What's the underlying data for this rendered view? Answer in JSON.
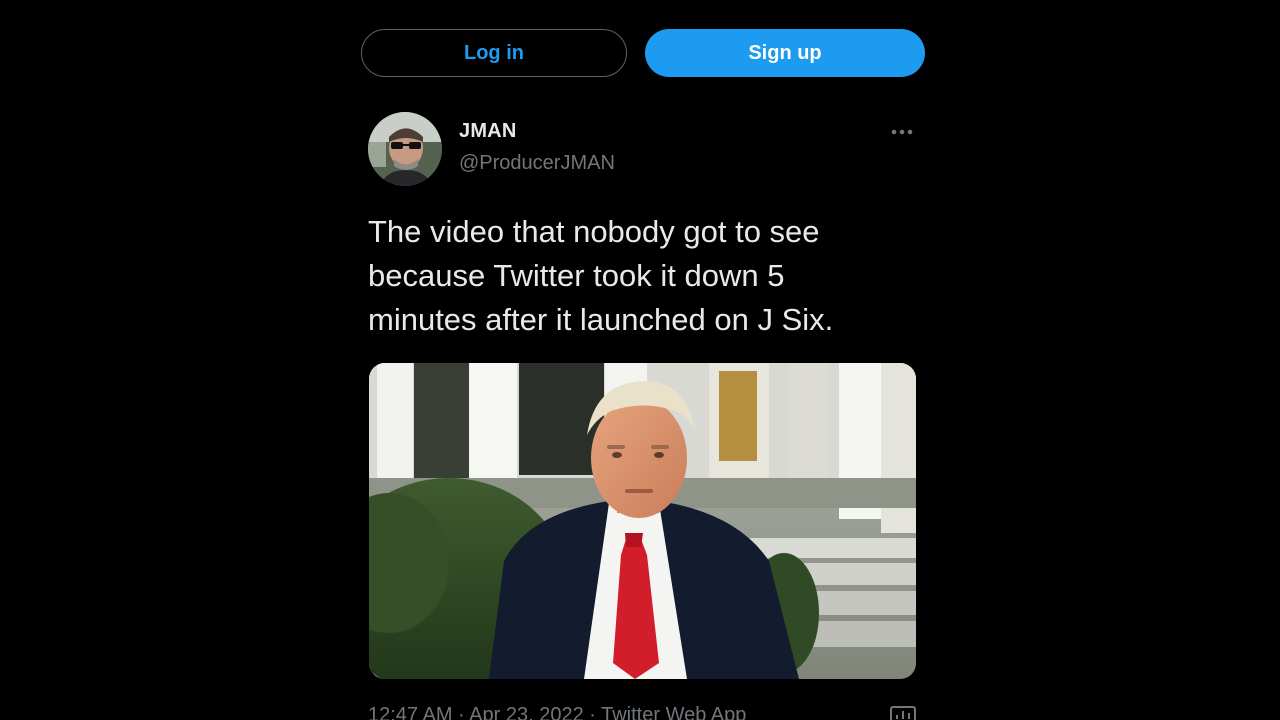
{
  "auth": {
    "login_label": "Log in",
    "signup_label": "Sign up"
  },
  "tweet": {
    "author": {
      "display_name": "JMAN",
      "handle": "@ProducerJMAN"
    },
    "text": "The video that nobody got to see\nbecause Twitter took it down 5\nminutes after it launched on J Six.",
    "meta": "12:47 AM · Apr 23, 2022 · Twitter Web App",
    "more_icon": "more-horizontal-icon",
    "analytics_icon": "analytics-icon"
  },
  "colors": {
    "background": "#000000",
    "accent": "#1d9bf0",
    "primary_text": "#e7e9ea",
    "secondary_text": "#71767b",
    "border": "#536471"
  }
}
